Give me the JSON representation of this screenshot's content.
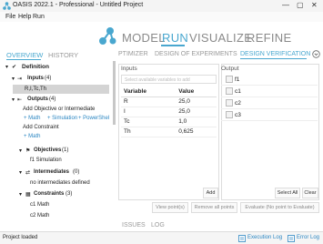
{
  "window": {
    "title": "OASIS 2022.1 - Professional - Untitled Project",
    "minimize": "—",
    "maximize": "▢",
    "close": "✕"
  },
  "menu": [
    "File",
    "Help",
    "Run"
  ],
  "nav": {
    "items": [
      "MODEL",
      "RUN",
      "VISUALIZE",
      "REFINE"
    ],
    "active": "RUN"
  },
  "left_tabs": [
    "OVERVIEW",
    "HISTORY"
  ],
  "tree": {
    "definition": "Definition",
    "inputs": "Inputs",
    "inputs_count": "(4)",
    "inputs_value": "R,I,Tc,Th",
    "outputs": "Outputs",
    "outputs_count": "(4)",
    "add_objective": "Add Objective or Intermediate",
    "links_row1": [
      "+ Math",
      "+ Simulation",
      "+ PowerShel"
    ],
    "add_constraint": "Add Constraint",
    "link_math": "+ Math",
    "objectives": "Objectives",
    "objectives_count": "(1)",
    "objective_item": "f1  Simulation",
    "intermediates": "Intermediates",
    "intermediates_count": "(0)",
    "intermediates_empty": "no intermediates defined",
    "constraints": "Constraints",
    "constraints_count": "(3)",
    "constraint_items": [
      "c1  Math",
      "c2  Math"
    ]
  },
  "right_tabs": [
    "PTIMIZER",
    "DESIGN OF EXPERIMENTS",
    "DESIGN VERIFICATION"
  ],
  "inputs_panel": {
    "header": "Inputs",
    "placeholder": "Select available variables to add",
    "columns": [
      "Variable",
      "Value"
    ],
    "rows": [
      {
        "variable": "R",
        "value": "25,0"
      },
      {
        "variable": "I",
        "value": "25,0"
      },
      {
        "variable": "Tc",
        "value": "1,0"
      },
      {
        "variable": "Th",
        "value": "0,625"
      }
    ],
    "add_button": "Add"
  },
  "outputs_panel": {
    "header": "Output",
    "items": [
      "f1",
      "c1",
      "c2",
      "c3"
    ],
    "select_all": "Select All",
    "clear": "Clear"
  },
  "action_buttons": [
    "View point(s)",
    "Remove all points",
    "Evaluate (No point to Evaluate)"
  ],
  "bottom_tabs": [
    "ISSUES",
    "LOG"
  ],
  "status": {
    "text": "Project loaded",
    "execution_log": "Execution Log",
    "error_log": "Error Log"
  },
  "colors": {
    "accent": "#49a7cf",
    "link": "#2a86c2"
  }
}
